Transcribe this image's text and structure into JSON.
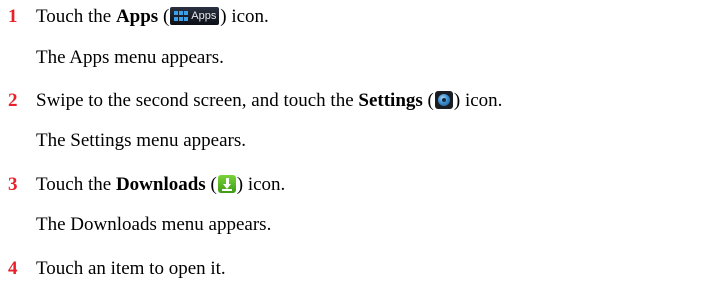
{
  "steps": [
    {
      "number": "1",
      "pre": "Touch the ",
      "bold": "Apps",
      "open_paren": " (",
      "close_paren": ") icon.",
      "result": "The Apps menu appears."
    },
    {
      "number": "2",
      "pre": "Swipe to the second screen, and touch the ",
      "bold": "Settings",
      "open_paren": " (",
      "close_paren": ") icon.",
      "result": "The Settings menu appears."
    },
    {
      "number": "3",
      "pre": "Touch the ",
      "bold": "Downloads",
      "open_paren": " (",
      "close_paren": ") icon.",
      "result": "The Downloads menu appears."
    },
    {
      "number": "4",
      "text": "Touch an item to open it."
    }
  ],
  "icons": {
    "apps_label": "Apps",
    "apps_icon": "apps-grid-icon",
    "settings_icon": "settings-icon",
    "downloads_icon": "download-icon"
  },
  "colors": {
    "step_number": "#e8202a",
    "text": "#000000"
  }
}
